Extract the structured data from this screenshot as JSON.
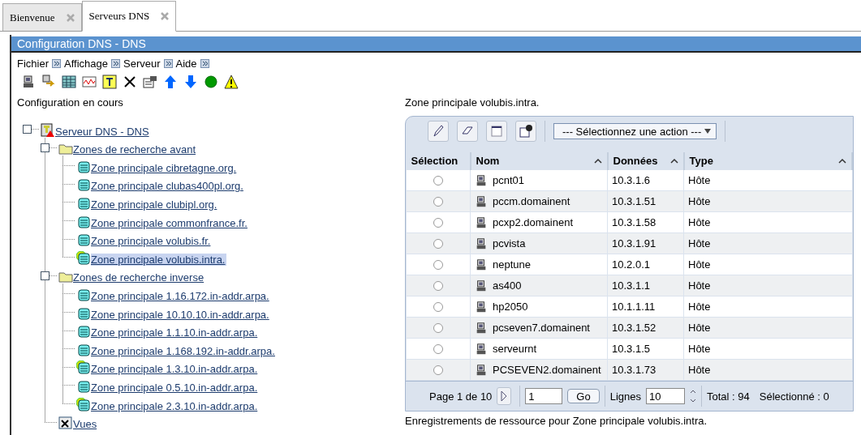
{
  "tabs": [
    {
      "label": "Bienvenue",
      "selected": false
    },
    {
      "label": "Serveurs DNS",
      "selected": true
    }
  ],
  "panel": {
    "title": "Configuration DNS - DNS"
  },
  "menu": [
    "Fichier",
    "Affichage",
    "Serveur",
    "Aide"
  ],
  "tree": {
    "heading": "Configuration en cours",
    "root": {
      "label": "Serveur DNS - DNS",
      "kind": "server",
      "expanded": true,
      "selected": false,
      "children": [
        {
          "label": "Zones de recherche avant",
          "kind": "folder",
          "expanded": true,
          "selected": false,
          "children": [
            {
              "label": "Zone principale cibretagne.org.",
              "kind": "zone",
              "selected": false
            },
            {
              "label": "Zone principale clubas400pl.org.",
              "kind": "zone",
              "selected": false
            },
            {
              "label": "Zone principale clubipl.org.",
              "kind": "zone",
              "selected": false
            },
            {
              "label": "Zone principale commonfrance.fr.",
              "kind": "zone",
              "selected": false
            },
            {
              "label": "Zone principale volubis.fr.",
              "kind": "zone",
              "selected": false
            },
            {
              "label": "Zone principale volubis.intra.",
              "kind": "zone-active",
              "selected": true
            }
          ]
        },
        {
          "label": "Zones de recherche inverse",
          "kind": "folder",
          "expanded": true,
          "selected": false,
          "children": [
            {
              "label": "Zone principale 1.16.172.in-addr.arpa.",
              "kind": "zone",
              "selected": false
            },
            {
              "label": "Zone principale 10.10.10.in-addr.arpa.",
              "kind": "zone",
              "selected": false
            },
            {
              "label": "Zone principale 1.1.10.in-addr.arpa.",
              "kind": "zone",
              "selected": false
            },
            {
              "label": "Zone principale 1.168.192.in-addr.arpa.",
              "kind": "zone",
              "selected": false
            },
            {
              "label": "Zone principale 1.3.10.in-addr.arpa.",
              "kind": "zone-active",
              "selected": false
            },
            {
              "label": "Zone principale 0.5.10.in-addr.arpa.",
              "kind": "zone",
              "selected": false
            },
            {
              "label": "Zone principale 2.3.10.in-addr.arpa.",
              "kind": "zone-active",
              "selected": false
            }
          ]
        },
        {
          "label": "Vues",
          "kind": "views",
          "selected": false
        }
      ]
    }
  },
  "records": {
    "heading": "Zone principale volubis.intra.",
    "action_select": "--- Sélectionnez une action ---",
    "columns": [
      {
        "label": "Sélection",
        "sortable": false
      },
      {
        "label": "Nom",
        "sortable": true
      },
      {
        "label": "Données",
        "sortable": true
      },
      {
        "label": "Type",
        "sortable": true
      }
    ],
    "rows": [
      {
        "name": "pcnt01",
        "data": "10.3.1.6",
        "type": "Hôte",
        "selected": false
      },
      {
        "name": "pccm.domainent",
        "data": "10.3.1.51",
        "type": "Hôte",
        "selected": false
      },
      {
        "name": "pcxp2.domainent",
        "data": "10.3.1.58",
        "type": "Hôte",
        "selected": false
      },
      {
        "name": "pcvista",
        "data": "10.3.1.91",
        "type": "Hôte",
        "selected": false
      },
      {
        "name": "neptune",
        "data": "10.2.0.1",
        "type": "Hôte",
        "selected": false
      },
      {
        "name": "as400",
        "data": "10.3.1.1",
        "type": "Hôte",
        "selected": false
      },
      {
        "name": "hp2050",
        "data": "10.1.1.11",
        "type": "Hôte",
        "selected": false
      },
      {
        "name": "pcseven7.domainent",
        "data": "10.3.1.52",
        "type": "Hôte",
        "selected": false
      },
      {
        "name": "serveurnt",
        "data": "10.3.1.5",
        "type": "Hôte",
        "selected": false
      },
      {
        "name": "PCSEVEN2.domainent",
        "data": "10.3.1.73",
        "type": "Hôte",
        "selected": false
      }
    ],
    "footer": {
      "page": "Page 1 de 10",
      "page_input": "1",
      "go": "Go",
      "lines_label": "Lignes",
      "lines_input": "10",
      "total": "Total : 94",
      "selected_count": "Sélectionné : 0"
    },
    "caption": "Enregistrements de ressource pour Zone principale volubis.intra."
  }
}
